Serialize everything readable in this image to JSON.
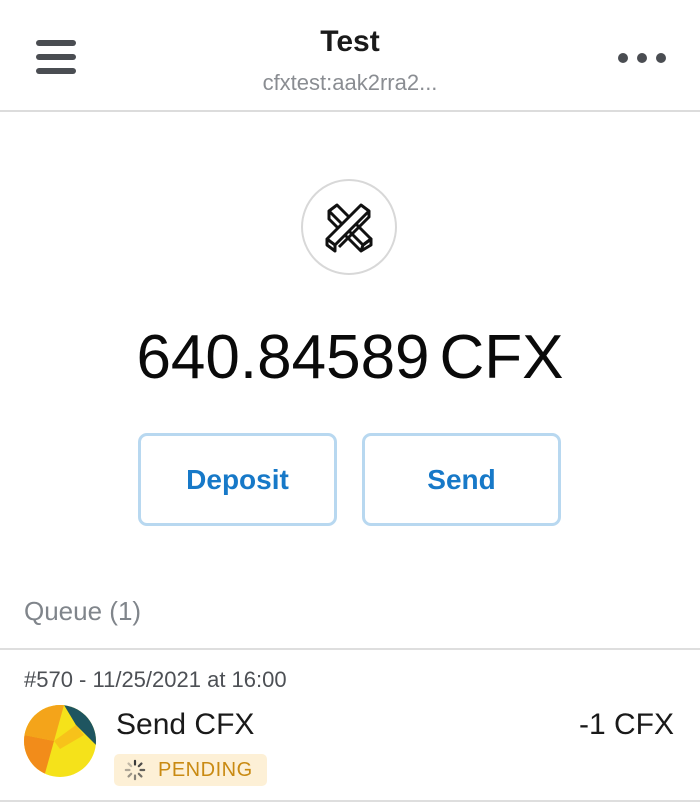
{
  "header": {
    "title": "Test",
    "address": "cfxtest:aak2rra2...",
    "menu_icon": "hamburger-menu-icon",
    "more_icon": "more-horizontal-icon"
  },
  "wallet": {
    "logo_icon": "conflux-logo-icon",
    "balance": "640.84589",
    "unit": "CFX"
  },
  "actions": {
    "deposit_label": "Deposit",
    "send_label": "Send"
  },
  "queue": {
    "label": "Queue (1)",
    "items": [
      {
        "meta": "#570 - 11/25/2021 at 16:00",
        "title": "Send CFX",
        "amount": "-1 CFX",
        "status": "PENDING",
        "status_icon": "spinner-icon"
      }
    ]
  },
  "colors": {
    "accent": "#1779c8",
    "button_border": "#b8d8f0",
    "pending_bg": "#fdf0d6",
    "pending_text": "#c98a12"
  }
}
